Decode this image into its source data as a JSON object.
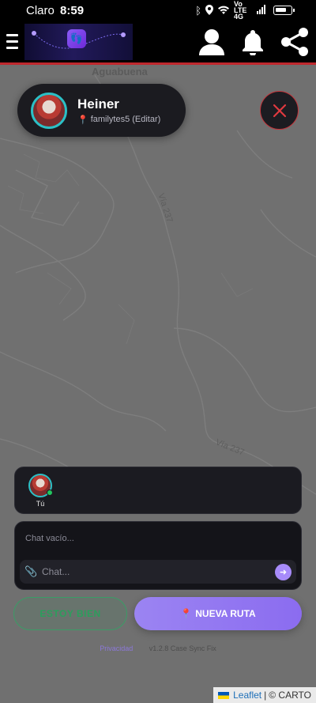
{
  "status_bar": {
    "carrier": "Claro",
    "time": "8:59",
    "network_labels": "Vo LTE 4G"
  },
  "header": {
    "icons": [
      "menu-icon",
      "app-logo",
      "person-icon",
      "bell-icon",
      "share-icon"
    ]
  },
  "map": {
    "place_label": "Aguabuena",
    "road_labels": [
      "Vía 237",
      "Vía 237"
    ]
  },
  "user_card": {
    "name": "Heiner",
    "group": "familytes5",
    "edit_label": "(Editar)"
  },
  "members": [
    {
      "label": "Tú",
      "status": "online"
    }
  ],
  "chat": {
    "empty_text": "Chat vacío...",
    "input_placeholder": "Chat..."
  },
  "actions": {
    "ok_label": "ESTOY BIEN",
    "route_label": "NUEVA RUTA"
  },
  "footer": {
    "privacy": "Privacidad",
    "version": "v1.2.8 Case Sync Fix"
  },
  "attribution": {
    "leaflet": "Leaflet",
    "separator": "|",
    "carto": "© CARTO"
  },
  "colors": {
    "accent": "#8b6cf0",
    "danger": "#c4343a",
    "success": "#2c9e5c",
    "avatar_ring": "#2bc0c6"
  }
}
